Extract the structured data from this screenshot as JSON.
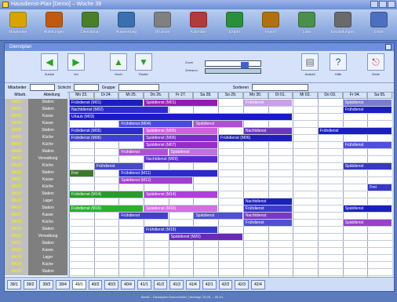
{
  "window": {
    "title": "Hausdienst-Plan [Demo] – Woche 39"
  },
  "toolbar1": [
    {
      "label": "Mitarbeiter",
      "icon": "people-icon",
      "color": "#d9a400"
    },
    {
      "label": "Abteilungen",
      "icon": "building-icon",
      "color": "#c05a10"
    },
    {
      "label": "Dienstplan",
      "icon": "calendar-icon",
      "color": "#4a7f2a"
    },
    {
      "label": "Auswertung",
      "icon": "chart-icon",
      "color": "#3a6fb0"
    },
    {
      "label": "Drucken",
      "icon": "printer-icon",
      "color": "#808080"
    },
    {
      "label": "Kalender",
      "icon": "date-icon",
      "color": "#b23a3a"
    },
    {
      "label": "Export",
      "icon": "export-icon",
      "color": "#2a8f3a"
    },
    {
      "label": "Import",
      "icon": "import-icon",
      "color": "#b07010"
    },
    {
      "label": "Liste",
      "icon": "list-icon",
      "color": "#4a8f4a"
    },
    {
      "label": "Einstellungen",
      "icon": "tools-icon",
      "color": "#6a6a6a"
    },
    {
      "label": "Ende",
      "icon": "exit-icon",
      "color": "#4d6fbf"
    }
  ],
  "inner": {
    "title": "Dienstplan"
  },
  "toolbar2": [
    {
      "label": "Zurück",
      "glyph": "◀"
    },
    {
      "label": "Vor",
      "glyph": "▶"
    },
    {
      "label": "Hoch",
      "glyph": "▲"
    },
    {
      "label": "Runter",
      "glyph": "▼"
    }
  ],
  "slider": {
    "label1": "Zoom",
    "label2": "Zeitraum"
  },
  "toolbar2_right": [
    {
      "label": "Ansicht",
      "glyph": "▤"
    },
    {
      "label": "Hilfe",
      "glyph": "?"
    },
    {
      "label": "Ende",
      "glyph": "⎋"
    }
  ],
  "filter": {
    "l1": "Mitarbeiter",
    "l2": "Schicht",
    "l3": "Gruppe",
    "l4": "Sortieren"
  },
  "leftcol": {
    "headers": [
      "Mitarb.",
      "Abteilung"
    ],
    "rows": [
      [
        "MA01",
        "Station"
      ],
      [
        "MA02",
        "Station"
      ],
      [
        "MA03",
        "Kasse"
      ],
      [
        "MA04",
        "Kasse"
      ],
      [
        "MA05",
        "Station"
      ],
      [
        "MA06",
        "Küche"
      ],
      [
        "MA07",
        "Küche"
      ],
      [
        "MA08",
        "Station"
      ],
      [
        "MA09",
        "Verwaltung"
      ],
      [
        "MA10",
        "Küche"
      ],
      [
        "MA11",
        "Station"
      ],
      [
        "MA12",
        "Kasse"
      ],
      [
        "MA13",
        "Küche"
      ],
      [
        "MA14",
        "Station"
      ],
      [
        "MA15",
        "Lager"
      ],
      [
        "MA16",
        "Station"
      ],
      [
        "MA17",
        "Kasse"
      ],
      [
        "MA18",
        "Küche"
      ],
      [
        "MA19",
        "Station"
      ],
      [
        "MA20",
        "Verwaltung"
      ],
      [
        "MA21",
        "Station"
      ],
      [
        "MA22",
        "Kasse"
      ],
      [
        "MA23",
        "Lager"
      ],
      [
        "MA24",
        "Küche"
      ],
      [
        "MA25",
        "Station"
      ]
    ]
  },
  "schedule": {
    "days": [
      "Mo 23.",
      "Di 24.",
      "Mi 25.",
      "Do 26.",
      "Fr 27.",
      "Sa 28.",
      "So 29.",
      "Mo 30.",
      "Di 01.",
      "Mi 02.",
      "Do 03.",
      "Fr 04.",
      "Sa 05."
    ],
    "blocks": [
      {
        "row": 0,
        "col": 0,
        "span": 3,
        "text": "Frühdienst (M01)",
        "color": "#1b1fbf"
      },
      {
        "row": 0,
        "col": 3,
        "span": 3,
        "text": "Spätdienst (M01)",
        "color": "#9a18b8"
      },
      {
        "row": 0,
        "col": 7,
        "span": 2,
        "text": "Frühdienst",
        "color": "#c8a0e8"
      },
      {
        "row": 0,
        "col": 11,
        "span": 2,
        "text": "Spätdienst",
        "color": "#7a7ad8"
      },
      {
        "row": 1,
        "col": 0,
        "span": 4,
        "text": "Nachtdienst (M02)",
        "color": "#2a2ad0"
      },
      {
        "row": 1,
        "col": 11,
        "span": 2,
        "text": "Frühdienst",
        "color": "#1b1fbf"
      },
      {
        "row": 2,
        "col": 0,
        "span": 9,
        "text": "Urlaub (M03)",
        "color": "#1a1ac8"
      },
      {
        "row": 3,
        "col": 2,
        "span": 3,
        "text": "Frühdienst (M04)",
        "color": "#4a4ae0"
      },
      {
        "row": 3,
        "col": 5,
        "span": 2,
        "text": "Spätdienst",
        "color": "#b050d0"
      },
      {
        "row": 4,
        "col": 0,
        "span": 3,
        "text": "Frühdienst (M05)",
        "color": "#2b2bc8"
      },
      {
        "row": 4,
        "col": 3,
        "span": 3,
        "text": "Spätdienst (M05)",
        "color": "#d060e0"
      },
      {
        "row": 4,
        "col": 7,
        "span": 2,
        "text": "Nachtdienst",
        "color": "#6a38c0"
      },
      {
        "row": 4,
        "col": 10,
        "span": 3,
        "text": "Frühdienst",
        "color": "#1b1fbf"
      },
      {
        "row": 5,
        "col": 0,
        "span": 3,
        "text": "Frühdienst (M06)",
        "color": "#3f3fd0"
      },
      {
        "row": 5,
        "col": 3,
        "span": 3,
        "text": "Spätdienst (M06)",
        "color": "#7a2cc8"
      },
      {
        "row": 5,
        "col": 6,
        "span": 3,
        "text": "Frühdienst (M06)",
        "color": "#1f1fb8"
      },
      {
        "row": 6,
        "col": 3,
        "span": 3,
        "text": "Spätdienst (M07)",
        "color": "#9a2ad0"
      },
      {
        "row": 6,
        "col": 11,
        "span": 2,
        "text": "Frühdienst",
        "color": "#5050d8"
      },
      {
        "row": 7,
        "col": 2,
        "span": 2,
        "text": "Frühdienst",
        "color": "#b050d8"
      },
      {
        "row": 7,
        "col": 4,
        "span": 2,
        "text": "Spätdienst",
        "color": "#c070e0"
      },
      {
        "row": 8,
        "col": 3,
        "span": 3,
        "text": "Nachtdienst (M09)",
        "color": "#5a2ad0"
      },
      {
        "row": 9,
        "col": 1,
        "span": 2,
        "text": "Frühdienst",
        "color": "#4848c8"
      },
      {
        "row": 9,
        "col": 11,
        "span": 2,
        "text": "Spätdienst",
        "color": "#3838c0"
      },
      {
        "row": 10,
        "col": 0,
        "span": 1,
        "text": "Frei",
        "color": "#3a7a2a"
      },
      {
        "row": 10,
        "col": 2,
        "span": 4,
        "text": "Frühdienst (M11)",
        "color": "#2a2ad0"
      },
      {
        "row": 11,
        "col": 2,
        "span": 3,
        "text": "Spätdienst (M12)",
        "color": "#a040d0"
      },
      {
        "row": 12,
        "col": 12,
        "span": 1,
        "text": "Frei",
        "color": "#3838c0"
      },
      {
        "row": 13,
        "col": 0,
        "span": 3,
        "text": "Frühdienst (M14)",
        "color": "#2a9a2a"
      },
      {
        "row": 13,
        "col": 3,
        "span": 3,
        "text": "Spätdienst (M14)",
        "color": "#b040d8"
      },
      {
        "row": 14,
        "col": 7,
        "span": 2,
        "text": "Nachtdienst",
        "color": "#1b1fbf"
      },
      {
        "row": 15,
        "col": 0,
        "span": 3,
        "text": "Frühdienst (M16)",
        "color": "#2ab02a"
      },
      {
        "row": 15,
        "col": 3,
        "span": 3,
        "text": "Spätdienst (M16)",
        "color": "#d070e0"
      },
      {
        "row": 15,
        "col": 7,
        "span": 2,
        "text": "Frühdienst",
        "color": "#3c3cc8"
      },
      {
        "row": 15,
        "col": 11,
        "span": 2,
        "text": "Spätdienst",
        "color": "#1b1fbf"
      },
      {
        "row": 16,
        "col": 2,
        "span": 2,
        "text": "Frühdienst",
        "color": "#4040c8"
      },
      {
        "row": 16,
        "col": 5,
        "span": 2,
        "text": "Spätdienst",
        "color": "#5050d0"
      },
      {
        "row": 16,
        "col": 7,
        "span": 2,
        "text": "Nachtdienst",
        "color": "#7a38c8"
      },
      {
        "row": 17,
        "col": 7,
        "span": 2,
        "text": "Frühdienst",
        "color": "#5050d0"
      },
      {
        "row": 17,
        "col": 11,
        "span": 2,
        "text": "Spätdienst",
        "color": "#9a40d0"
      },
      {
        "row": 18,
        "col": 3,
        "span": 3,
        "text": "Frühdienst (M19)",
        "color": "#3a3ac8"
      },
      {
        "row": 19,
        "col": 4,
        "span": 3,
        "text": "Spätdienst (M20)",
        "color": "#6a2ab8"
      }
    ]
  },
  "tabs": [
    "39/1",
    "39/2",
    "39/3",
    "39/4",
    "40/1",
    "40/2",
    "40/3",
    "40/4",
    "41/1",
    "41/2",
    "41/3",
    "41/4",
    "42/1",
    "42/2",
    "42/3",
    "42/4"
  ],
  "bottombar": {
    "text": "Bereit – Dienstplan Demoversion   |   Anzeige: 23.09. – 05.10."
  }
}
